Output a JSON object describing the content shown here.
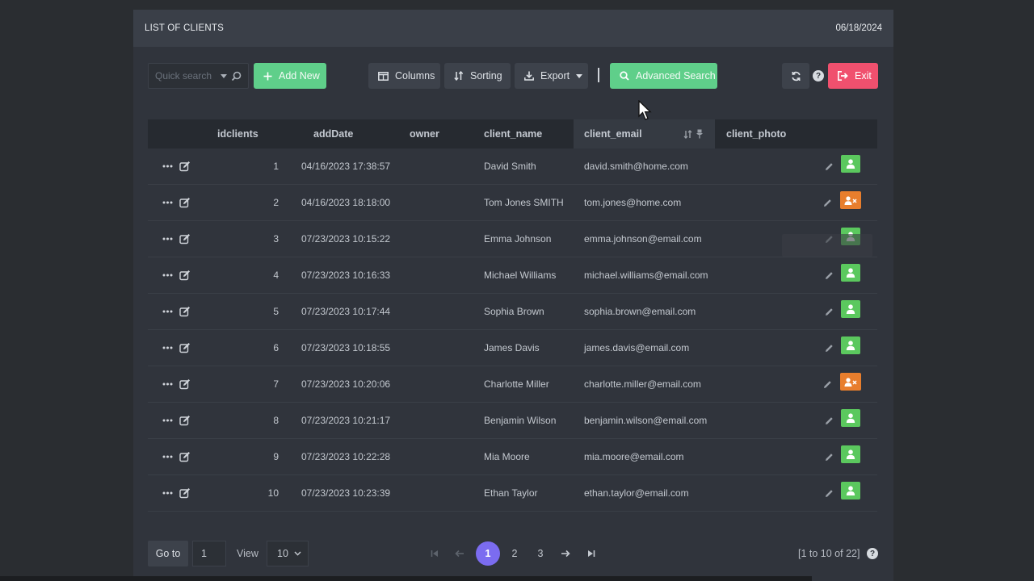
{
  "header": {
    "title": "LIST OF CLIENTS",
    "date": "06/18/2024"
  },
  "toolbar": {
    "search_placeholder": "Quick search",
    "add_new": "Add New",
    "columns": "Columns",
    "sorting": "Sorting",
    "export": "Export",
    "advanced_search": "Advanced Search",
    "exit": "Exit",
    "help": "?"
  },
  "table": {
    "columns": [
      "idclients",
      "addDate",
      "owner",
      "client_name",
      "client_email",
      "client_photo"
    ],
    "sorted_column": "client_email",
    "rows": [
      {
        "id": "1",
        "date": "04/16/2023 17:38:57",
        "name": "David Smith",
        "email": "david.smith@home.com",
        "status": "active"
      },
      {
        "id": "2",
        "date": "04/16/2023 18:18:00",
        "name": "Tom Jones SMITH",
        "email": "tom.jones@home.com",
        "status": "inactive"
      },
      {
        "id": "3",
        "date": "07/23/2023 10:15:22",
        "name": "Emma Johnson",
        "email": "emma.johnson@email.com",
        "status": "active"
      },
      {
        "id": "4",
        "date": "07/23/2023 10:16:33",
        "name": "Michael Williams",
        "email": "michael.williams@email.com",
        "status": "active"
      },
      {
        "id": "5",
        "date": "07/23/2023 10:17:44",
        "name": "Sophia Brown",
        "email": "sophia.brown@email.com",
        "status": "active"
      },
      {
        "id": "6",
        "date": "07/23/2023 10:18:55",
        "name": "James Davis",
        "email": "james.davis@email.com",
        "status": "active"
      },
      {
        "id": "7",
        "date": "07/23/2023 10:20:06",
        "name": "Charlotte Miller",
        "email": "charlotte.miller@email.com",
        "status": "inactive"
      },
      {
        "id": "8",
        "date": "07/23/2023 10:21:17",
        "name": "Benjamin Wilson",
        "email": "benjamin.wilson@email.com",
        "status": "active"
      },
      {
        "id": "9",
        "date": "07/23/2023 10:22:28",
        "name": "Mia Moore",
        "email": "mia.moore@email.com",
        "status": "active"
      },
      {
        "id": "10",
        "date": "07/23/2023 10:23:39",
        "name": "Ethan Taylor",
        "email": "ethan.taylor@email.com",
        "status": "active"
      }
    ]
  },
  "footer": {
    "goto_label": "Go to",
    "page_value": "1",
    "view_label": "View",
    "view_value": "10",
    "pages": [
      "1",
      "2",
      "3"
    ],
    "current_page": "1",
    "range": "[1 to 10 of 22]",
    "help": "?"
  },
  "colors": {
    "green": "#5fcf8a",
    "exit": "#f0506e",
    "active_page": "#7b6cf0",
    "user_active": "#5bc85e",
    "user_inactive": "#e87e2d"
  }
}
